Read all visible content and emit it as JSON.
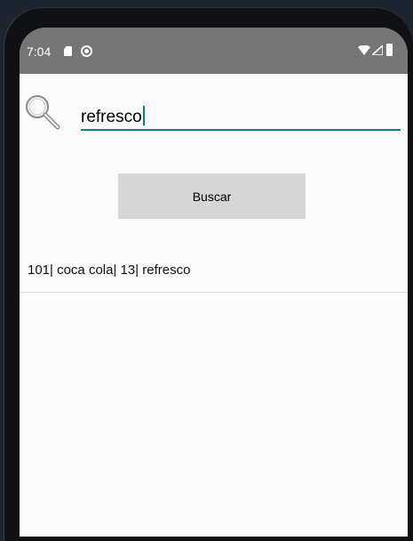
{
  "status_bar": {
    "time": "7:04",
    "background": "#757575"
  },
  "search": {
    "value": "refresco",
    "accent_color": "#00897b",
    "icon": "magnifier-icon"
  },
  "buscar_button": {
    "label": "Buscar",
    "background": "#d6d6d6"
  },
  "results": [
    {
      "text": "101| coca cola| 13| refresco"
    }
  ]
}
